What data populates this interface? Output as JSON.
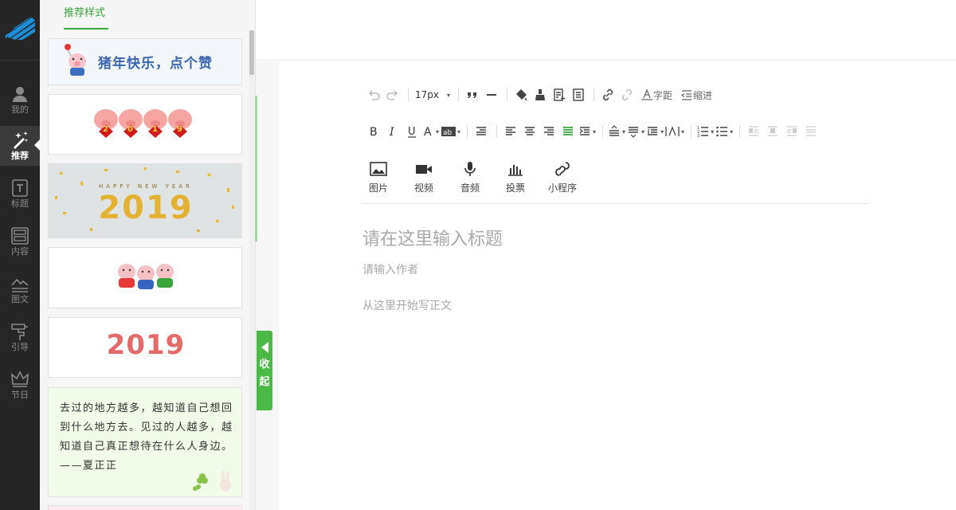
{
  "rail": {
    "items": [
      {
        "label": "我的",
        "icon": "user-icon"
      },
      {
        "label": "推荐",
        "icon": "magic-wand-icon"
      },
      {
        "label": "标题",
        "icon": "title-icon"
      },
      {
        "label": "内容",
        "icon": "content-icon"
      },
      {
        "label": "图文",
        "icon": "image-text-icon"
      },
      {
        "label": "引导",
        "icon": "signpost-icon"
      },
      {
        "label": "节日",
        "icon": "crown-icon"
      }
    ],
    "active_label": "推荐"
  },
  "panel": {
    "tab_label": "推荐样式",
    "cards": {
      "banner_text": "猪年快乐，点个赞",
      "pigs_badges": [
        "2",
        "0",
        "1",
        "9"
      ],
      "happy_new_year": "HAPPY NEW YEAR",
      "year_gold": "2019",
      "year_pink": "2019",
      "quote": "去过的地方越多，越知道自己想回到什么地方去。见过的人越多，越知道自己真正想待在什么人身边。——夏正正"
    },
    "collapse_label": "收起"
  },
  "toolbar": {
    "font_size": "17px",
    "letter_spacing_label": "字距",
    "indent_label": "缩进",
    "row1_icons": [
      "undo-icon",
      "redo-icon",
      "font-size-dropdown",
      "quote-icon",
      "horizontal-rule-icon",
      "format-painter-icon",
      "clear-format-icon",
      "insert-template-icon",
      "document-icon",
      "link-icon",
      "unlink-icon",
      "letter-spacing-icon",
      "indent-icon"
    ],
    "row2_icons": [
      "bold-icon",
      "italic-icon",
      "underline-icon",
      "font-color-icon",
      "background-color-icon",
      "first-line-indent-icon",
      "align-left-icon",
      "align-center-icon",
      "align-right-icon",
      "justify-icon",
      "text-indent-icon",
      "paragraph-spacing-top-icon",
      "paragraph-spacing-bottom-icon",
      "line-height-icon",
      "letter-width-icon",
      "ordered-list-icon",
      "unordered-list-icon",
      "float-left-icon",
      "float-center-icon",
      "float-right-icon",
      "float-none-icon"
    ],
    "media": [
      {
        "label": "图片",
        "icon": "image-icon"
      },
      {
        "label": "视频",
        "icon": "video-icon"
      },
      {
        "label": "音频",
        "icon": "microphone-icon"
      },
      {
        "label": "投票",
        "icon": "vote-chart-icon"
      },
      {
        "label": "小程序",
        "icon": "mini-program-icon"
      }
    ]
  },
  "editor": {
    "title_placeholder": "请在这里输入标题",
    "author_placeholder": "请输入作者",
    "body_placeholder": "从这里开始写正文"
  },
  "colors": {
    "accent": "#3aa53a",
    "collapse_tab": "#4cb847",
    "rail_bg": "#262626",
    "logo_blue": "#1c8fd6"
  }
}
